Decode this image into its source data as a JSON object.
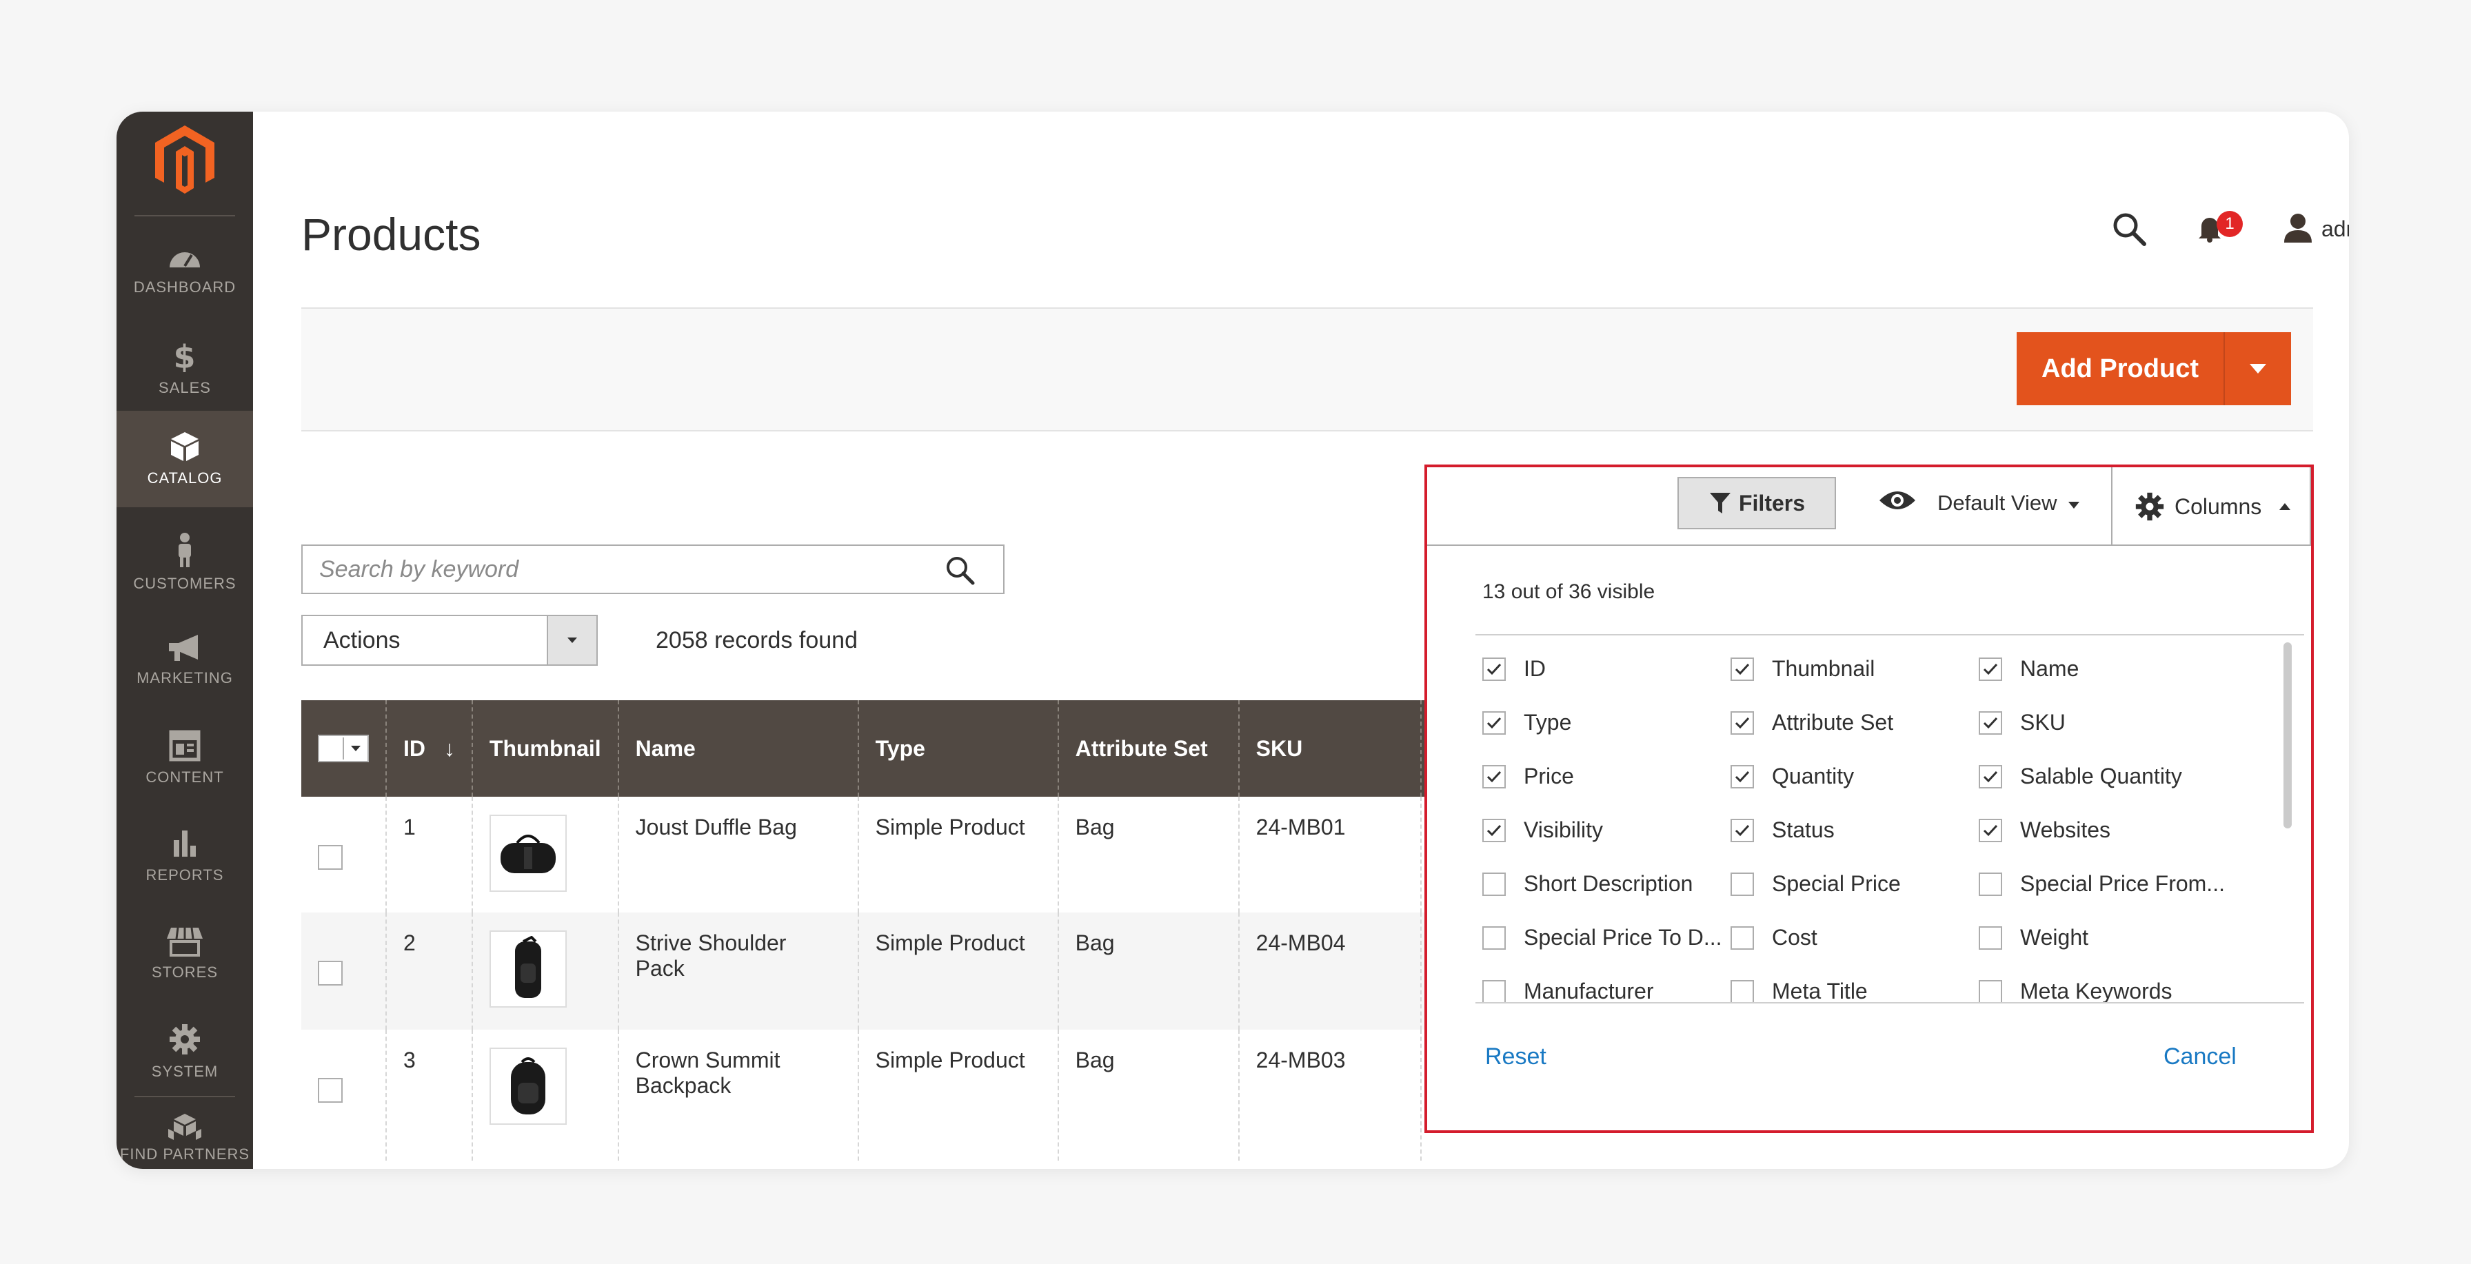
{
  "sidebar": {
    "items": [
      {
        "label": "DASHBOARD",
        "icon": "dashboard-icon"
      },
      {
        "label": "SALES",
        "icon": "dollar-icon"
      },
      {
        "label": "CATALOG",
        "icon": "box-icon",
        "active": true
      },
      {
        "label": "CUSTOMERS",
        "icon": "person-icon"
      },
      {
        "label": "MARKETING",
        "icon": "megaphone-icon"
      },
      {
        "label": "CONTENT",
        "icon": "layout-icon"
      },
      {
        "label": "REPORTS",
        "icon": "bar-chart-icon"
      },
      {
        "label": "STORES",
        "icon": "store-icon"
      },
      {
        "label": "SYSTEM",
        "icon": "gear-icon"
      },
      {
        "label": "FIND PARTNERS",
        "icon": "cubes-icon"
      }
    ]
  },
  "header": {
    "title": "Products",
    "notifications": "1",
    "user": "admin"
  },
  "toolbar": {
    "add_label": "Add Product",
    "search_placeholder": "Search by keyword",
    "actions_label": "Actions",
    "records": "2058 records found",
    "filters_label": "Filters",
    "view_label": "Default View",
    "columns_label": "Columns"
  },
  "grid": {
    "headers": [
      "ID",
      "Thumbnail",
      "Name",
      "Type",
      "Attribute Set",
      "SKU"
    ],
    "rows": [
      {
        "id": "1",
        "name": "Joust Duffle Bag",
        "type": "Simple Product",
        "attr": "Bag",
        "sku": "24-MB01"
      },
      {
        "id": "2",
        "name": "Strive Shoulder Pack",
        "type": "Simple Product",
        "attr": "Bag",
        "sku": "24-MB04"
      },
      {
        "id": "3",
        "name": "Crown Summit Backpack",
        "type": "Simple Product",
        "attr": "Bag",
        "sku": "24-MB03"
      }
    ]
  },
  "columns_panel": {
    "visible_count": "13 out of 36 visible",
    "items": [
      {
        "label": "ID",
        "checked": true
      },
      {
        "label": "Thumbnail",
        "checked": true
      },
      {
        "label": "Name",
        "checked": true
      },
      {
        "label": "Type",
        "checked": true
      },
      {
        "label": "Attribute Set",
        "checked": true
      },
      {
        "label": "SKU",
        "checked": true
      },
      {
        "label": "Price",
        "checked": true
      },
      {
        "label": "Quantity",
        "checked": true
      },
      {
        "label": "Salable Quantity",
        "checked": true
      },
      {
        "label": "Visibility",
        "checked": true
      },
      {
        "label": "Status",
        "checked": true
      },
      {
        "label": "Websites",
        "checked": true
      },
      {
        "label": "Short Description",
        "checked": false
      },
      {
        "label": "Special Price",
        "checked": false
      },
      {
        "label": "Special Price From...",
        "checked": false
      },
      {
        "label": "Special Price To D...",
        "checked": false
      },
      {
        "label": "Cost",
        "checked": false
      },
      {
        "label": "Weight",
        "checked": false
      },
      {
        "label": "Manufacturer",
        "checked": false
      },
      {
        "label": "Meta Title",
        "checked": false
      },
      {
        "label": "Meta Keywords",
        "checked": false
      }
    ],
    "reset_label": "Reset",
    "cancel_label": "Cancel"
  },
  "colors": {
    "accent": "#e3531d",
    "sidebar": "#373330",
    "header_row": "#514943",
    "link": "#1979c3",
    "highlight": "#d41c2c"
  }
}
